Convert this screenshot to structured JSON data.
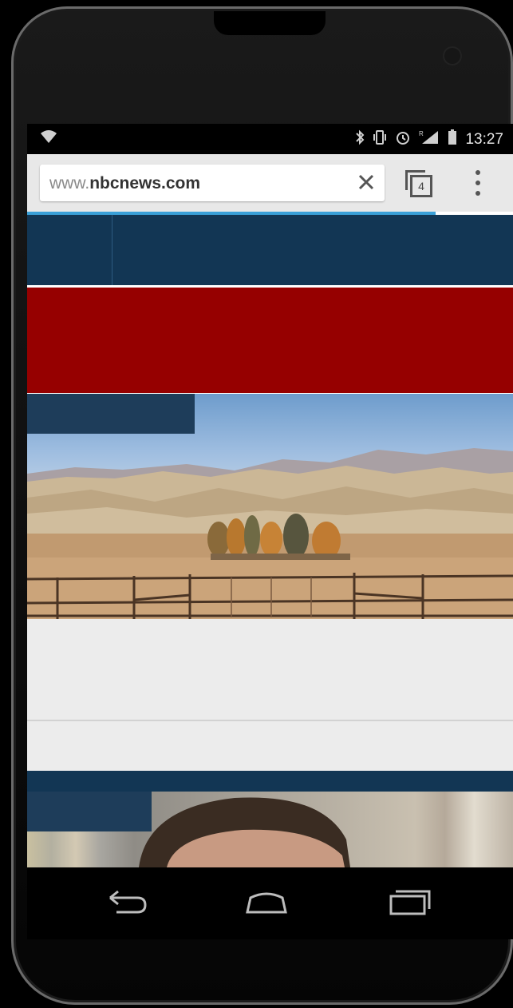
{
  "status_bar": {
    "time": "13:27",
    "icons": [
      "wifi-icon",
      "bluetooth-icon",
      "vibrate-icon",
      "alarm-icon",
      "signal-icon",
      "battery-icon"
    ]
  },
  "browser": {
    "url_prefix": "www.",
    "url_domain": "nbcnews.com",
    "tab_count": "4",
    "icons": [
      "clear-icon",
      "tabs-icon",
      "overflow-menu-icon"
    ],
    "progress_fraction": 0.84
  },
  "page_colors": {
    "nav_band": "#123654",
    "red_band": "#960000",
    "label_block": "#1e3d5a",
    "gray_block": "#ececec",
    "progress": "#3aa0d8"
  },
  "nav_bar": {
    "icons": [
      "back-icon",
      "home-icon",
      "recents-icon"
    ]
  }
}
